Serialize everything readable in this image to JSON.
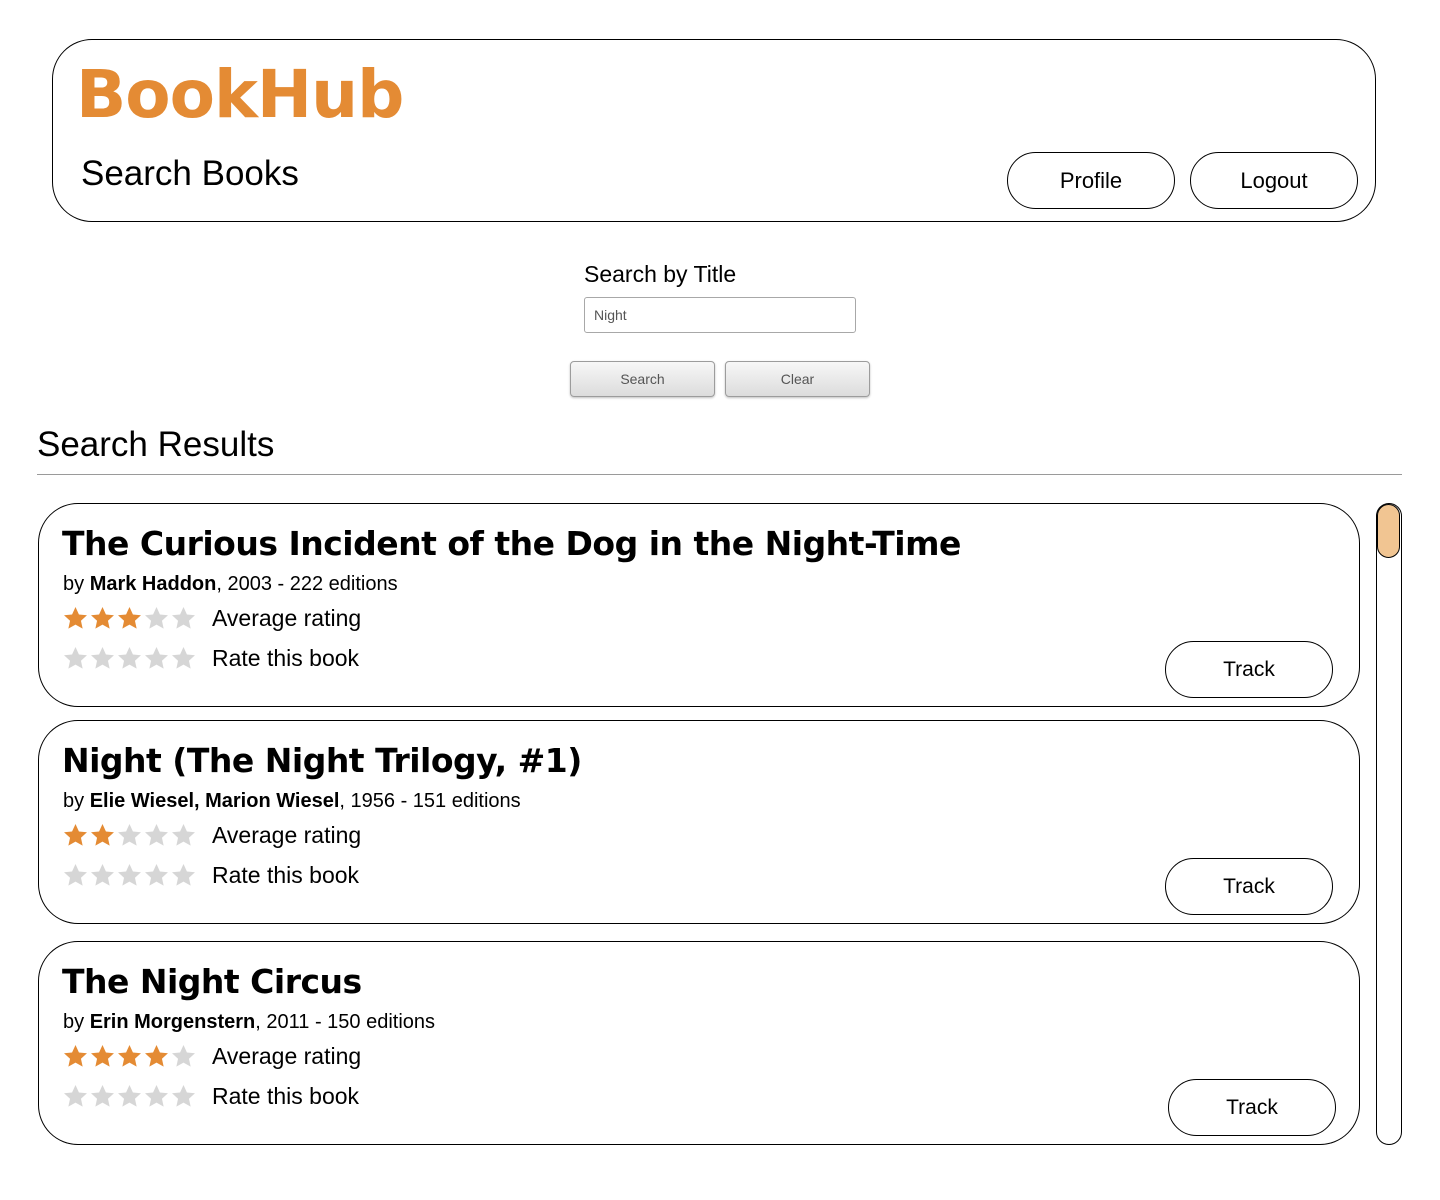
{
  "app": {
    "logo": "BookHub",
    "page_title": "Search Books",
    "brand_color": "#E48B34"
  },
  "header": {
    "profile_label": "Profile",
    "logout_label": "Logout"
  },
  "search": {
    "label": "Search by Title",
    "value": "Night",
    "search_label": "Search",
    "clear_label": "Clear"
  },
  "results": {
    "heading": "Search Results",
    "items": [
      {
        "title": "The Curious Incident of the Dog in the Night-Time",
        "by": "by ",
        "author": "Mark Haddon",
        "details": ", 2003 - 222 editions",
        "average_stars": 3,
        "user_stars": 0,
        "average_label": "Average rating",
        "rate_label": "Rate this book",
        "track_label": "Track"
      },
      {
        "title": "Night (The Night Trilogy, #1)",
        "by": "by ",
        "author": "Elie Wiesel, Marion Wiesel",
        "details": ", 1956 - 151 editions",
        "average_stars": 2,
        "user_stars": 0,
        "average_label": "Average rating",
        "rate_label": "Rate this book",
        "track_label": "Track"
      },
      {
        "title": "The Night Circus",
        "by": "by ",
        "author": "Erin Morgenstern",
        "details": ", 2011 - 150 editions",
        "average_stars": 4,
        "user_stars": 0,
        "average_label": "Average rating",
        "rate_label": "Rate this book",
        "track_label": "Track"
      }
    ]
  },
  "stars": {
    "max": 5,
    "filled_color": "#E48B34",
    "empty_color": "#D6D6D6",
    "icon": "star-icon"
  },
  "scrollbar": {
    "thumb_color": "#F1C592",
    "position": 0
  }
}
